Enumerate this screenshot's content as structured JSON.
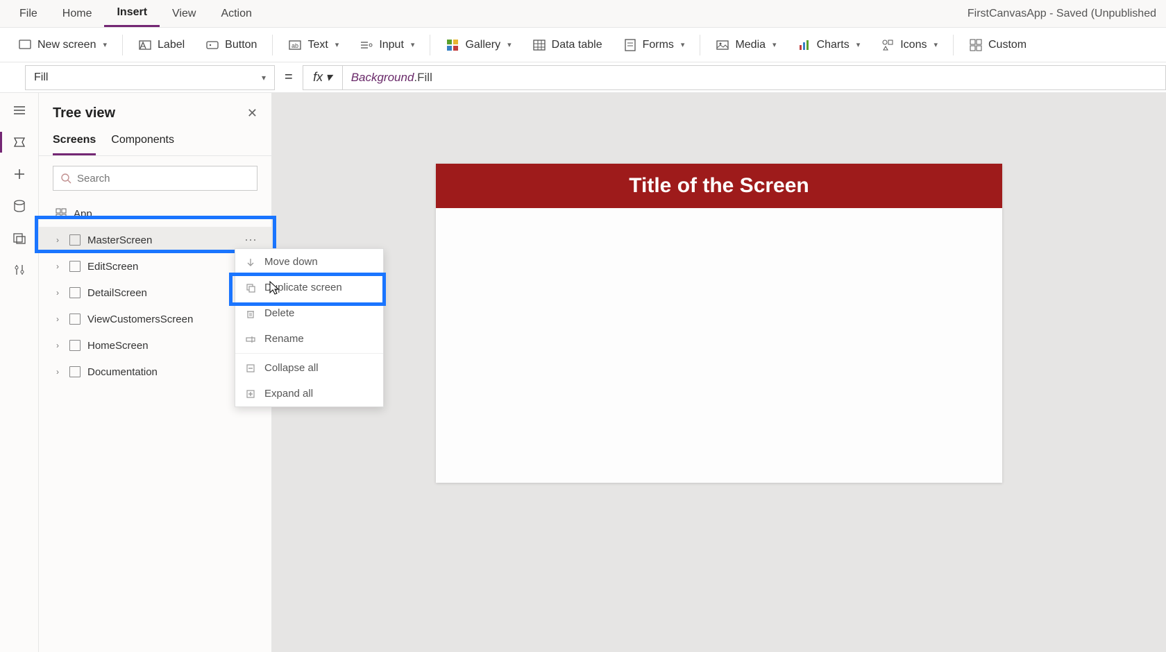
{
  "app_title": "FirstCanvasApp - Saved (Unpublished",
  "menubar": {
    "file": "File",
    "home": "Home",
    "insert": "Insert",
    "view": "View",
    "action": "Action"
  },
  "ribbon": {
    "new_screen": "New screen",
    "label": "Label",
    "button": "Button",
    "text": "Text",
    "input": "Input",
    "gallery": "Gallery",
    "data_table": "Data table",
    "forms": "Forms",
    "media": "Media",
    "charts": "Charts",
    "icons": "Icons",
    "custom": "Custom"
  },
  "formula": {
    "property": "Fill",
    "fx": "fx",
    "expr_obj": "Background",
    "expr_prop": ".Fill"
  },
  "sidepanel": {
    "title": "Tree view",
    "tabs": {
      "screens": "Screens",
      "components": "Components"
    },
    "search_placeholder": "Search",
    "app_label": "App",
    "items": [
      {
        "label": "MasterScreen"
      },
      {
        "label": "EditScreen"
      },
      {
        "label": "DetailScreen"
      },
      {
        "label": "ViewCustomersScreen"
      },
      {
        "label": "HomeScreen"
      },
      {
        "label": "Documentation"
      }
    ]
  },
  "context_menu": {
    "move_down": "Move down",
    "duplicate": "Duplicate screen",
    "delete": "Delete",
    "rename": "Rename",
    "collapse_all": "Collapse all",
    "expand_all": "Expand all"
  },
  "canvas": {
    "title_text": "Title of the Screen"
  }
}
